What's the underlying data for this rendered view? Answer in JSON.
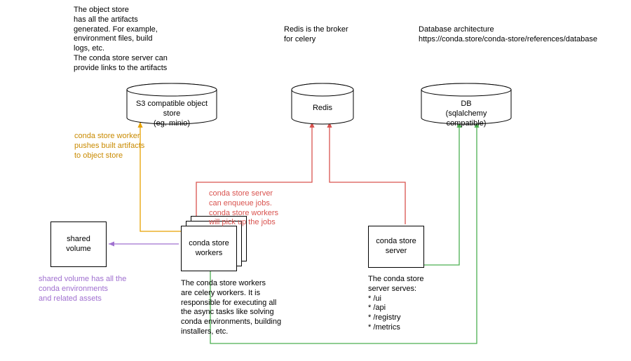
{
  "nodes": {
    "objectStore": {
      "line1": "S3 compatible object",
      "line2": "store",
      "line3": "(eg. minio)"
    },
    "redis": {
      "line1": "Redis"
    },
    "db": {
      "line1": "DB",
      "line2": "(sqlalchemy",
      "line3": "compatible)"
    },
    "sharedVolume": {
      "line1": "shared",
      "line2": "volume"
    },
    "workers": {
      "line1": "conda store",
      "line2": "workers"
    },
    "server": {
      "line1": "conda store",
      "line2": "server"
    }
  },
  "annotations": {
    "objectStoreDesc": "The object store\nhas all the artifacts\ngenerated. For example,\nenvironment files, build\nlogs, etc.\nThe conda store server can\nprovide links to the artifacts",
    "redisDesc": "Redis is the broker\nfor celery",
    "dbDesc": "Database architecture\nhttps://conda.store/conda-store/references/database",
    "artifactsArrow": "conda store worker\npushes built artifacts\nto object store",
    "sharedVolDesc": "shared volume has all the\nconda environments\nand related assets",
    "queueDesc": "conda store server\ncan enqueue jobs.\nconda store workers\nwill pick up the jobs",
    "workersDesc": "The conda store workers\nare celery workers. It is\nresponsible for executing all\nthe async tasks like solving\nconda environments, building\ninstallers, etc.",
    "serverDesc": "The conda store\nserver serves:\n* /ui\n* /api\n* /registry\n* /metrics"
  }
}
